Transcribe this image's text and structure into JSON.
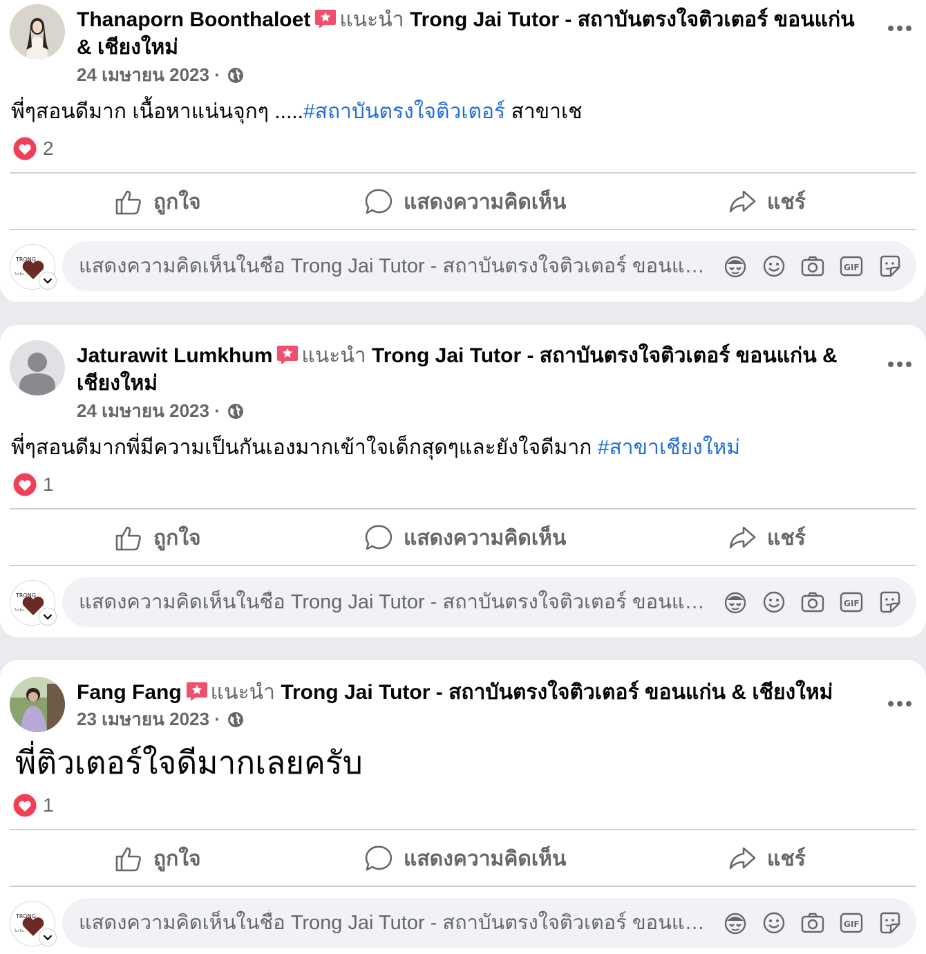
{
  "posts": [
    {
      "author": "Thanaporn Boonthaloet",
      "recommends": "แนะนำ",
      "page": "Trong Jai Tutor - สถาบันตรงใจติวเตอร์ ขอนแก่น & เชียงใหม่",
      "date": "24 เมษายน 2023 ·",
      "text_before": "พี่ๆสอนดีมาก เนื้อหาแน่นจุกๆ .....",
      "hashtag": "#สถาบันตรงใจติวเตอร์",
      "text_after": " สาขาเช",
      "reaction_count": "2"
    },
    {
      "author": "Jaturawit Lumkhum",
      "recommends": "แนะนำ",
      "page": "Trong Jai Tutor - สถาบันตรงใจติวเตอร์ ขอนแก่น & เชียงใหม่",
      "date": "24 เมษายน 2023 ·",
      "text_before": "พี่ๆสอนดีมากพี่มีความเป็นกันเองมากเข้าใจเด็กสุดๆและยังใจดีมาก ",
      "hashtag": "#สาขาเชียงใหม่",
      "text_after": "",
      "reaction_count": "1"
    },
    {
      "author": "Fang Fang",
      "recommends": "แนะนำ",
      "page": "Trong Jai Tutor - สถาบันตรงใจติวเตอร์ ขอนแก่น & เชียงใหม่",
      "date": "23 เมษายน 2023 ·",
      "text_before": "พี่ติวเตอร์ใจดีมากเลยครับ",
      "hashtag": "",
      "text_after": "",
      "reaction_count": "1"
    }
  ],
  "actions": {
    "like": "ถูกใจ",
    "comment": "แสดงความคิดเห็น",
    "share": "แชร์"
  },
  "composer": {
    "placeholder": "แสดงความคิดเห็นในชื่อ Trong Jai Tutor - สถาบันตรงใจติวเตอร์ ขอนแก่น & เชียงใหม่"
  },
  "icons": {
    "badge": "recommend-star-icon",
    "privacy": "globe-icon",
    "reaction": "heart-reaction-icon",
    "composer_tools": [
      "avatar-sticker-icon",
      "emoji-icon",
      "camera-icon",
      "gif-icon",
      "sticker-icon"
    ]
  },
  "colors": {
    "hashtag": "#216fdb",
    "heart": "#f33e58",
    "badge": "#f0506e",
    "secondary_text": "#65676b"
  }
}
